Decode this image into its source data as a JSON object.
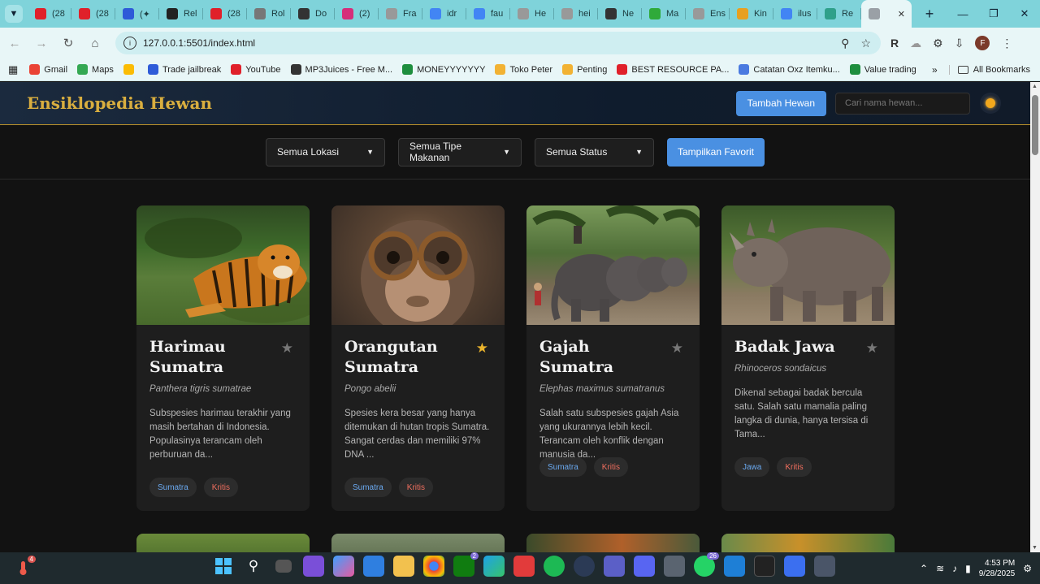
{
  "browser": {
    "tabs": [
      {
        "label": "(28",
        "color": "#e0202a"
      },
      {
        "label": "(28",
        "color": "#e0202a"
      },
      {
        "label": "(✦",
        "color": "#2e5bd8"
      },
      {
        "label": "Rel",
        "color": "#222222"
      },
      {
        "label": "(28",
        "color": "#e0202a"
      },
      {
        "label": "Rol",
        "color": "#777777"
      },
      {
        "label": "Do",
        "color": "#333333"
      },
      {
        "label": "(2)",
        "color": "#d62e7a"
      },
      {
        "label": "Fra",
        "color": "#999999"
      },
      {
        "label": "idr",
        "color": "#4285f4"
      },
      {
        "label": "fau",
        "color": "#4285f4"
      },
      {
        "label": "He",
        "color": "#999999"
      },
      {
        "label": "hei",
        "color": "#999999"
      },
      {
        "label": "Ne",
        "color": "#333333"
      },
      {
        "label": "Ma",
        "color": "#2faa3a"
      },
      {
        "label": "Ens",
        "color": "#999999"
      },
      {
        "label": "Kin",
        "color": "#e8a020"
      },
      {
        "label": "ilus",
        "color": "#4285f4"
      },
      {
        "label": "Re",
        "color": "#2fa08a"
      },
      {
        "label": "",
        "color": "#9aa0a6"
      }
    ],
    "url": "127.0.0.1:5501/index.html",
    "avatar_letter": "F",
    "bookmarks": [
      {
        "label": "Gmail",
        "color": "#ea4335"
      },
      {
        "label": "Maps",
        "color": "#34a853"
      },
      {
        "label": "",
        "color": "#fbbc04"
      },
      {
        "label": "Trade jailbreak",
        "color": "#2e5bd8"
      },
      {
        "label": "YouTube",
        "color": "#e0202a"
      },
      {
        "label": "MP3Juices - Free M...",
        "color": "#333333"
      },
      {
        "label": "MONEYYYYYYY",
        "color": "#1e8e3e"
      },
      {
        "label": "Toko Peter",
        "color": "#f2b233"
      },
      {
        "label": "Penting",
        "color": "#f2b233"
      },
      {
        "label": "BEST RESOURCE PA...",
        "color": "#e0202a"
      },
      {
        "label": "Catatan Oxz Itemku...",
        "color": "#4a7ae0"
      },
      {
        "label": "Value trading",
        "color": "#1e8e3e"
      }
    ],
    "all_bookmarks": "All Bookmarks"
  },
  "header": {
    "brand": "Ensiklopedia Hewan",
    "add_button": "Tambah Hewan",
    "search_placeholder": "Cari nama hewan..."
  },
  "filters": {
    "location": "Semua Lokasi",
    "food_type": "Semua Tipe Makanan",
    "status": "Semua Status",
    "favorite_button": "Tampilkan Favorit"
  },
  "animals": [
    {
      "name": "Harimau Sumatra",
      "scientific": "Panthera tigris sumatrae",
      "description": "Subspesies harimau terakhir yang masih bertahan di Indonesia. Populasinya terancam oleh perburuan da...",
      "location": "Sumatra",
      "status": "Kritis",
      "favorite": false
    },
    {
      "name": "Orangutan Sumatra",
      "scientific": "Pongo abelii",
      "description": "Spesies kera besar yang hanya ditemukan di hutan tropis Sumatra. Sangat cerdas dan memiliki 97% DNA ...",
      "location": "Sumatra",
      "status": "Kritis",
      "favorite": true
    },
    {
      "name": "Gajah Sumatra",
      "scientific": "Elephas maximus sumatranus",
      "description": "Salah satu subspesies gajah Asia yang ukurannya lebih kecil. Terancam oleh konflik dengan manusia da...",
      "location": "Sumatra",
      "status": "Kritis",
      "favorite": false
    },
    {
      "name": "Badak Jawa",
      "scientific": "Rhinoceros sondaicus",
      "description": "Dikenal sebagai badak bercula satu. Salah satu mamalia paling langka di dunia, hanya tersisa di Tama...",
      "location": "Jawa",
      "status": "Kritis",
      "favorite": false
    }
  ],
  "taskbar": {
    "weather_badge": "4",
    "time": "4:53 PM",
    "date": "9/28/2025",
    "badge_xbox": "2",
    "badge_whatsapp": "26"
  }
}
